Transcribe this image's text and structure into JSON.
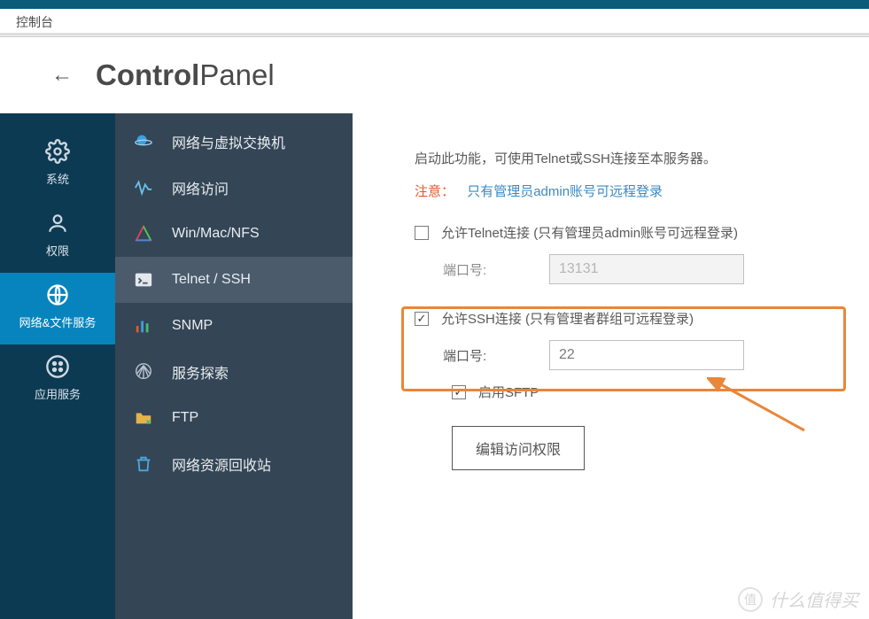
{
  "console_label": "控制台",
  "header": {
    "title_bold": "Control",
    "title_light": "Panel"
  },
  "leftbar": {
    "items": [
      {
        "label": "系统"
      },
      {
        "label": "权限"
      },
      {
        "label": "网络&文件服务"
      },
      {
        "label": "应用服务"
      }
    ]
  },
  "subnav": {
    "items": [
      {
        "label": "网络与虚拟交换机"
      },
      {
        "label": "网络访问"
      },
      {
        "label": "Win/Mac/NFS"
      },
      {
        "label": "Telnet / SSH"
      },
      {
        "label": "SNMP"
      },
      {
        "label": "服务探索"
      },
      {
        "label": "FTP"
      },
      {
        "label": "网络资源回收站"
      }
    ]
  },
  "content": {
    "description": "启动此功能，可使用Telnet或SSH连接至本服务器。",
    "note_label": "注意：",
    "note_text": "只有管理员admin账号可远程登录",
    "telnet_label": "允许Telnet连接 (只有管理员admin账号可远程登录)",
    "telnet_port_label": "端口号:",
    "telnet_port_value": "13131",
    "ssh_label": "允许SSH连接 (只有管理者群组可远程登录)",
    "ssh_port_label": "端口号:",
    "ssh_port_value": "22",
    "sftp_label": "启用SFTP",
    "edit_btn": "编辑访问权限"
  },
  "watermark": {
    "badge": "值",
    "text": "什么值得买"
  }
}
